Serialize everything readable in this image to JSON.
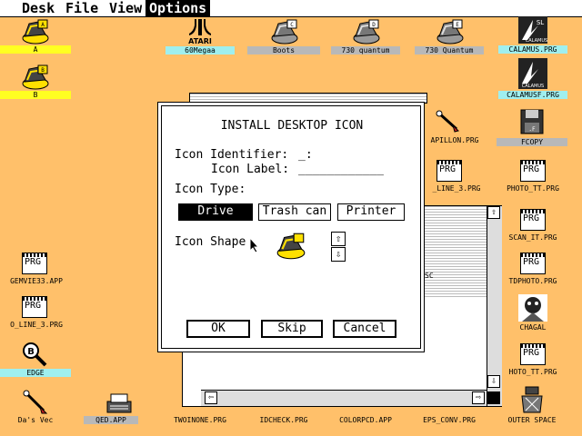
{
  "menubar": {
    "items": [
      "Desk",
      "File",
      "View",
      "Options"
    ],
    "active": "Options"
  },
  "desktop_icons": [
    {
      "label": "A",
      "icon": "drive-icon"
    },
    {
      "label": "B",
      "icon": "drive-icon"
    },
    {
      "label": "60Megaa",
      "icon": "atari-logo-icon"
    },
    {
      "label": "Boots",
      "icon": "drive-icon"
    },
    {
      "label": "730 quantum",
      "icon": "drive-icon"
    },
    {
      "label": "730 Quantum",
      "icon": "drive-icon"
    },
    {
      "label": "CALAMUS.PRG",
      "icon": "calamus-icon"
    },
    {
      "label": "CALAMUSF.PRG",
      "icon": "calamus-icon"
    },
    {
      "label": "APILLON.PRG",
      "icon": "pen-icon"
    },
    {
      "label": "FCOPY",
      "icon": "floppy-icon"
    },
    {
      "label": "_LINE_3.PRG",
      "icon": "program-icon"
    },
    {
      "label": "PHOTO_TT.PRG",
      "icon": "program-icon"
    },
    {
      "label": "SCAN_IT.PRG",
      "icon": "program-icon"
    },
    {
      "label": "TDPHOTO.PRG",
      "icon": "program-icon"
    },
    {
      "label": "CHAGAL",
      "icon": "chagal-icon"
    },
    {
      "label": "HOTO_TT.PRG",
      "icon": "program-icon"
    },
    {
      "label": "GEMVIE33.APP",
      "icon": "program-icon"
    },
    {
      "label": "O_LINE_3.PRG",
      "icon": "program-icon"
    },
    {
      "label": "EDGE",
      "icon": "edge-icon"
    },
    {
      "label": "Da's Vec",
      "icon": "pen-icon"
    },
    {
      "label": "QED.APP",
      "icon": "typewriter-icon"
    },
    {
      "label": "TWOINONE.PRG",
      "icon": "program-icon"
    },
    {
      "label": "IDCHECK.PRG",
      "icon": "program-icon"
    },
    {
      "label": "COLORPCD.APP",
      "icon": "program-icon"
    },
    {
      "label": "EPS_CONV.PRG",
      "icon": "program-icon"
    },
    {
      "label": "OUTER SPACE",
      "icon": "outer-space-icon"
    }
  ],
  "drive_letters": [
    "A",
    "B",
    "C",
    "D",
    "E"
  ],
  "calamus_text": [
    "SL",
    "CALAMUS"
  ],
  "program_glyph": "PRG",
  "background_window": {
    "partial_text": "SC"
  },
  "dialog": {
    "title": "INSTALL DESKTOP ICON",
    "identifier_label": "Icon Identifier:",
    "identifier_value": "_:",
    "label_label": "Icon Label:",
    "label_value": "____________",
    "type_label": "Icon Type:",
    "type_buttons": [
      "Drive",
      "Trash can",
      "Printer"
    ],
    "type_selected": "Drive",
    "shape_label": "Icon Shape",
    "shape_up": "⇧",
    "shape_down": "⇩",
    "ok": "OK",
    "skip": "Skip",
    "cancel": "Cancel"
  },
  "colors": {
    "desktop": "#FFC06A",
    "label_yellow": "#FFFF22",
    "label_cyan": "#9FEFEF",
    "label_grey": "#B8B8B8",
    "drive_yellow": "#FFE000"
  }
}
